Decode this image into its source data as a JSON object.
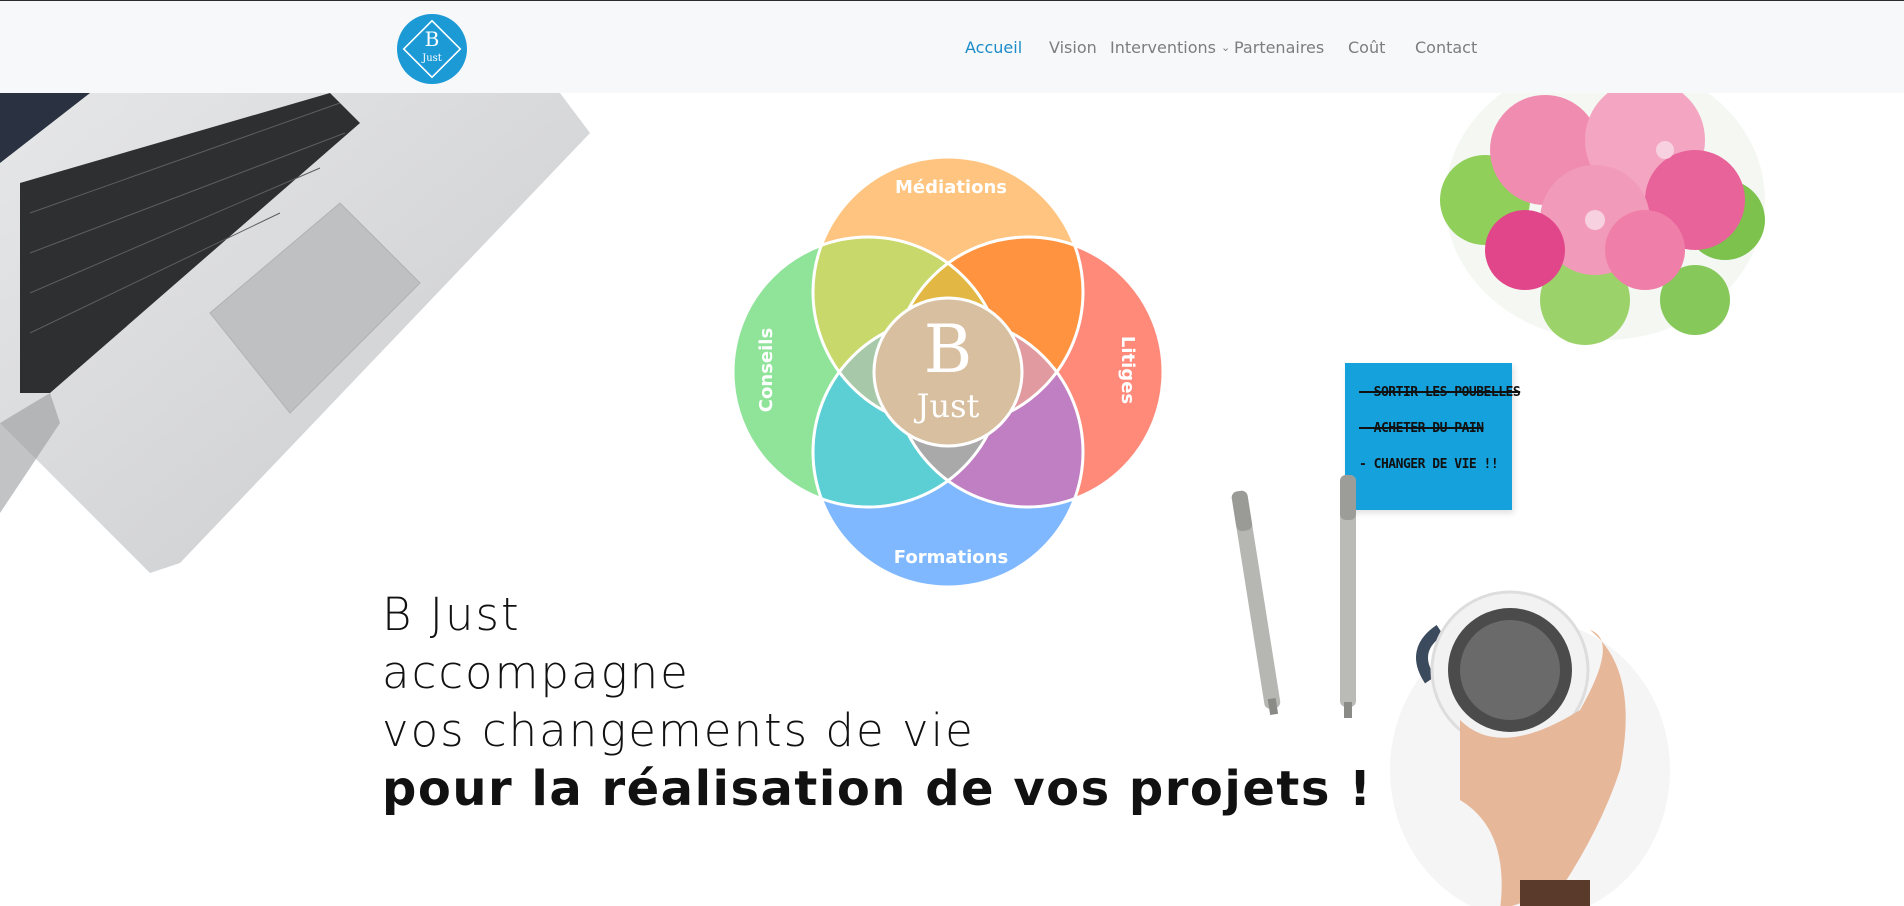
{
  "brand": {
    "logo_letter": "B",
    "logo_word": "Just",
    "color": "#1b9ad6"
  },
  "nav": {
    "items": [
      {
        "label": "Accueil",
        "active": true
      },
      {
        "label": "Vision",
        "active": false
      },
      {
        "label": "Interventions",
        "active": false,
        "has_dropdown": true
      },
      {
        "label": "Partenaires",
        "active": false
      },
      {
        "label": "Coût",
        "active": false
      },
      {
        "label": "Contact",
        "active": false
      }
    ],
    "active_color": "#1b8cc8",
    "text_color": "#7d7d7d"
  },
  "diagram": {
    "top": "Médiations",
    "right": "Litiges",
    "bottom": "Formations",
    "left": "Conseils",
    "center_letter": "B",
    "center_word": "Just",
    "colors": {
      "top": "#ffc47f",
      "right": "#ff8a7a",
      "bottom": "#7fb8ff",
      "left": "#8fe49a",
      "center": "#d8bfa0"
    }
  },
  "note": {
    "lines": [
      "- SORTIR LES POUBELLES",
      "- ACHETER DU PAIN",
      "- CHANGER DE VIE !!"
    ]
  },
  "hero": {
    "line1": "B Just",
    "line2": "accompagne",
    "line3": "vos changements de vie",
    "line4": "pour la réalisation de vos projets !"
  }
}
